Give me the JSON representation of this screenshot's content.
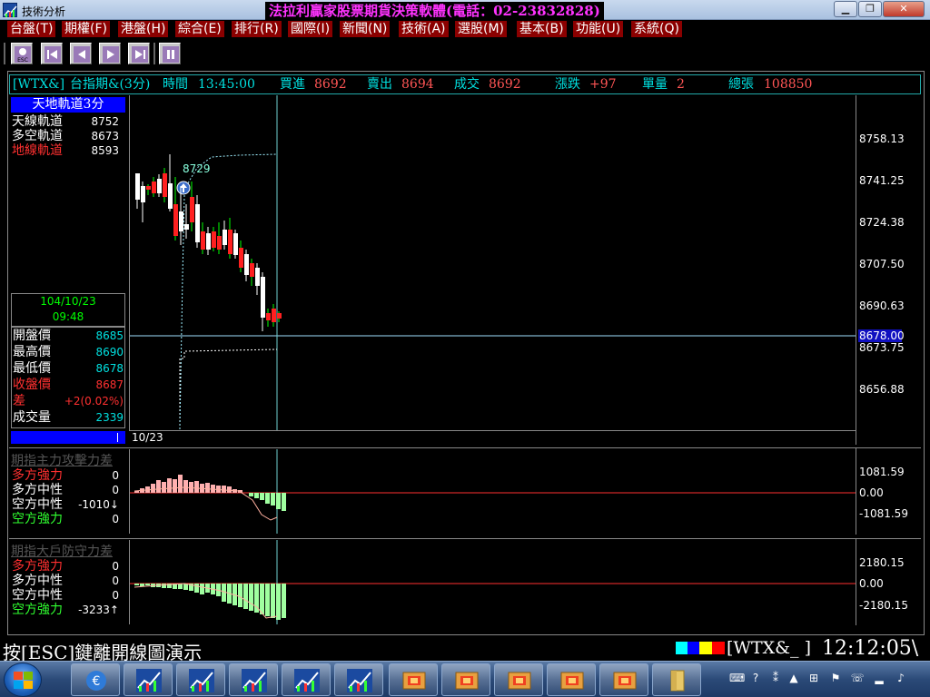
{
  "window": {
    "title": "技術分析",
    "banner": "法拉利贏家股票期貨決策軟體(電話：02-23832828)"
  },
  "menu": [
    {
      "label": "台盤(T)"
    },
    {
      "label": "期權(F)"
    },
    {
      "label": "港盤(H)"
    },
    {
      "label": "綜合(E)"
    },
    {
      "label": "排行(R)"
    },
    {
      "label": "國際(I)"
    },
    {
      "label": "新聞(N)"
    },
    {
      "label": "技術(A)"
    },
    {
      "label": "選股(M)"
    },
    {
      "label": "基本(B)"
    },
    {
      "label": "功能(U)"
    },
    {
      "label": "系統(Q)"
    }
  ],
  "toolbar": {
    "esc_label": "ESC",
    "buttons": [
      "esc-icon",
      "first-icon",
      "prev-icon",
      "next-icon",
      "last-icon",
      "pause-icon"
    ]
  },
  "infobar": {
    "symbol": "[WTX&]",
    "name": "台指期&(3分)",
    "time_label": "時間",
    "time": "13:45:00",
    "bid_label": "買進",
    "bid": "8692",
    "ask_label": "賣出",
    "ask": "8694",
    "last_label": "成交",
    "last": "8692",
    "change_label": "漲跌",
    "change": "+97",
    "volume_label": "單量",
    "volume": "2",
    "total_label": "總張",
    "total": "108850"
  },
  "indicator": {
    "title": "天地軌道3分",
    "rows": [
      {
        "label": "天線軌道",
        "value": "8752"
      },
      {
        "label": "多空軌道",
        "value": "8673"
      },
      {
        "label": "地線軌道",
        "value": "8593"
      }
    ]
  },
  "cursor_info": {
    "date": "104/10/23",
    "time": "09:48"
  },
  "quote": {
    "open_label": "開盤價",
    "open": "8685",
    "high_label": "最高價",
    "high": "8690",
    "low_label": "最低價",
    "low": "8678",
    "close_label": "收盤價",
    "close": "8687",
    "diff_label": "差",
    "diff": "+2(0.02%)",
    "vol_label": "成交量",
    "vol": "2339"
  },
  "main_chart": {
    "annotation": "8729",
    "date_label": "10/23",
    "scale": [
      "8758.13",
      "8741.25",
      "8724.38",
      "8707.50",
      "8690.63",
      "8673.75",
      "8656.88"
    ],
    "current_price": "8678.00"
  },
  "panel1": {
    "title": "期指主力攻擊力差",
    "rows": [
      {
        "label": "多方強力",
        "value": "0"
      },
      {
        "label": "多方中性",
        "value": "0"
      },
      {
        "label": "空方中性",
        "value": "-1010↓"
      },
      {
        "label": "空方強力",
        "value": "0"
      }
    ],
    "scale": [
      "1081.59",
      "0.00",
      "-1081.59"
    ]
  },
  "panel2": {
    "title": "期指大戶防守力差",
    "rows": [
      {
        "label": "多方強力",
        "value": "0"
      },
      {
        "label": "多方中性",
        "value": "0"
      },
      {
        "label": "空方中性",
        "value": "0"
      },
      {
        "label": "空方強力",
        "value": "-3233↑"
      }
    ],
    "scale": [
      "2180.15",
      "0.00",
      "-2180.15"
    ]
  },
  "status": {
    "message": "按[ESC]鍵離開線圖演示",
    "symbol": "[WTX&_  ]",
    "clock": "12:12:05\\"
  },
  "colors": {
    "menu_bg": "#8b0000",
    "bull": "#ff2020",
    "bear": "#ffffff",
    "cyan": "#00e0e0"
  }
}
